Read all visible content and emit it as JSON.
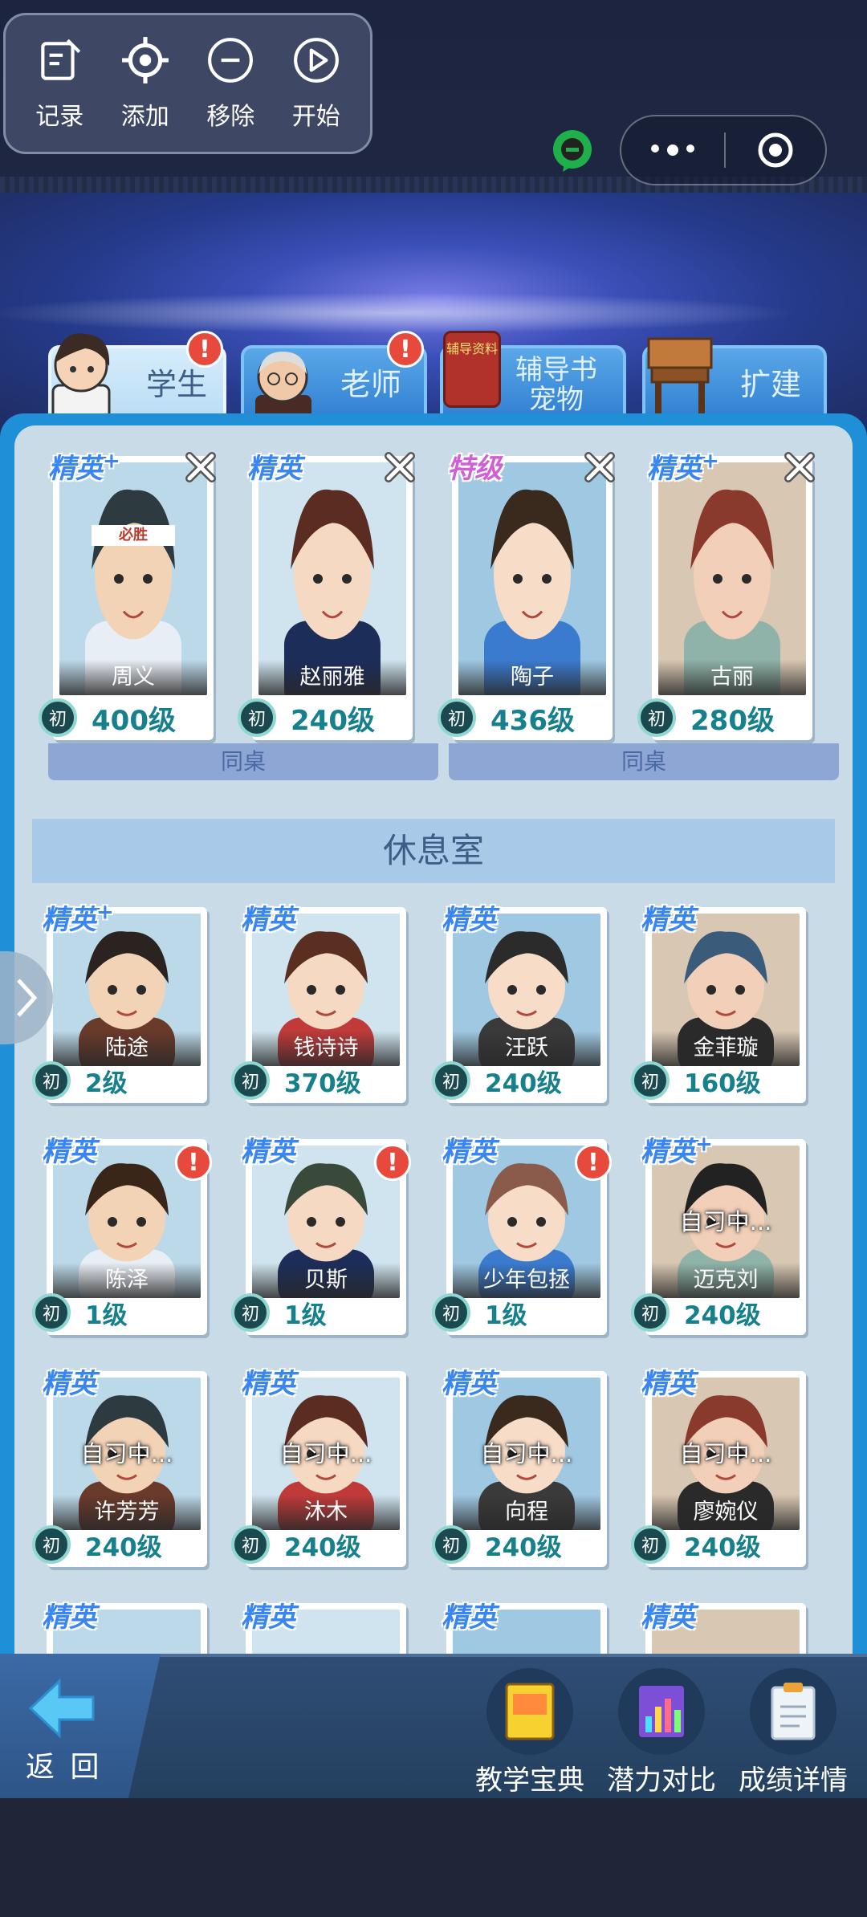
{
  "toolbar": [
    {
      "label": "记录",
      "icon": "record-icon"
    },
    {
      "label": "添加",
      "icon": "crosshair-add-icon"
    },
    {
      "label": "移除",
      "icon": "minus-circle-icon"
    },
    {
      "label": "开始",
      "icon": "play-circle-icon"
    }
  ],
  "tabs": [
    {
      "label": "学生",
      "active": true,
      "alert": "!"
    },
    {
      "label": "老师",
      "active": false,
      "alert": "!"
    },
    {
      "label": "辅导书\n宠物",
      "line1": "辅导书",
      "line2": "宠物",
      "active": false,
      "book_text": "辅导资料"
    },
    {
      "label": "扩建",
      "active": false
    }
  ],
  "desk": {
    "students": [
      {
        "rank": "精英",
        "plus": true,
        "name": "周义",
        "level": "400级",
        "badge": "初"
      },
      {
        "rank": "精英",
        "plus": false,
        "name": "赵丽雅",
        "level": "240级",
        "badge": "初"
      },
      {
        "rank": "特级",
        "plus": false,
        "name": "陶子",
        "level": "436级",
        "badge": "初"
      },
      {
        "rank": "精英",
        "plus": true,
        "name": "古丽",
        "level": "280级",
        "badge": "初"
      }
    ],
    "deskmate_label": "同桌",
    "headband": "必胜"
  },
  "lounge": {
    "title": "休息室",
    "students": [
      {
        "rank": "精英",
        "plus": true,
        "name": "陆途",
        "level": "2级",
        "badge": "初",
        "alert": false,
        "status": ""
      },
      {
        "rank": "精英",
        "plus": false,
        "name": "钱诗诗",
        "level": "370级",
        "badge": "初",
        "alert": false,
        "status": ""
      },
      {
        "rank": "精英",
        "plus": false,
        "name": "汪跃",
        "level": "240级",
        "badge": "初",
        "alert": false,
        "status": ""
      },
      {
        "rank": "精英",
        "plus": false,
        "name": "金菲璇",
        "level": "160级",
        "badge": "初",
        "alert": false,
        "status": ""
      },
      {
        "rank": "精英",
        "plus": false,
        "name": "陈泽",
        "level": "1级",
        "badge": "初",
        "alert": true,
        "status": ""
      },
      {
        "rank": "精英",
        "plus": false,
        "name": "贝斯",
        "level": "1级",
        "badge": "初",
        "alert": true,
        "status": ""
      },
      {
        "rank": "精英",
        "plus": false,
        "name": "少年包拯",
        "level": "1级",
        "badge": "初",
        "alert": true,
        "status": ""
      },
      {
        "rank": "精英",
        "plus": true,
        "name": "迈克刘",
        "level": "240级",
        "badge": "初",
        "alert": false,
        "status": "自习中..."
      },
      {
        "rank": "精英",
        "plus": false,
        "name": "许芳芳",
        "level": "240级",
        "badge": "初",
        "alert": false,
        "status": "自习中..."
      },
      {
        "rank": "精英",
        "plus": false,
        "name": "沐木",
        "level": "240级",
        "badge": "初",
        "alert": false,
        "status": "自习中..."
      },
      {
        "rank": "精英",
        "plus": false,
        "name": "向程",
        "level": "240级",
        "badge": "初",
        "alert": false,
        "status": "自习中..."
      },
      {
        "rank": "精英",
        "plus": false,
        "name": "廖婉仪",
        "level": "240级",
        "badge": "初",
        "alert": false,
        "status": "自习中..."
      }
    ],
    "partial_row_ranks": [
      "精英",
      "精英",
      "精英",
      "精英"
    ]
  },
  "bottom": {
    "back": "返 回",
    "buttons": [
      {
        "label": "教学宝典",
        "icon": "teaching-book-icon"
      },
      {
        "label": "潜力对比",
        "icon": "potential-chart-icon"
      },
      {
        "label": "成绩详情",
        "icon": "score-clipboard-icon"
      }
    ]
  },
  "colors": {
    "panel": "#c8dbe6",
    "frame": "#1f8fd8",
    "level_text": "#16808d",
    "rank_elite": "#3a86f0",
    "rank_special": "#d05fd5",
    "alert": "#e74a3c"
  }
}
